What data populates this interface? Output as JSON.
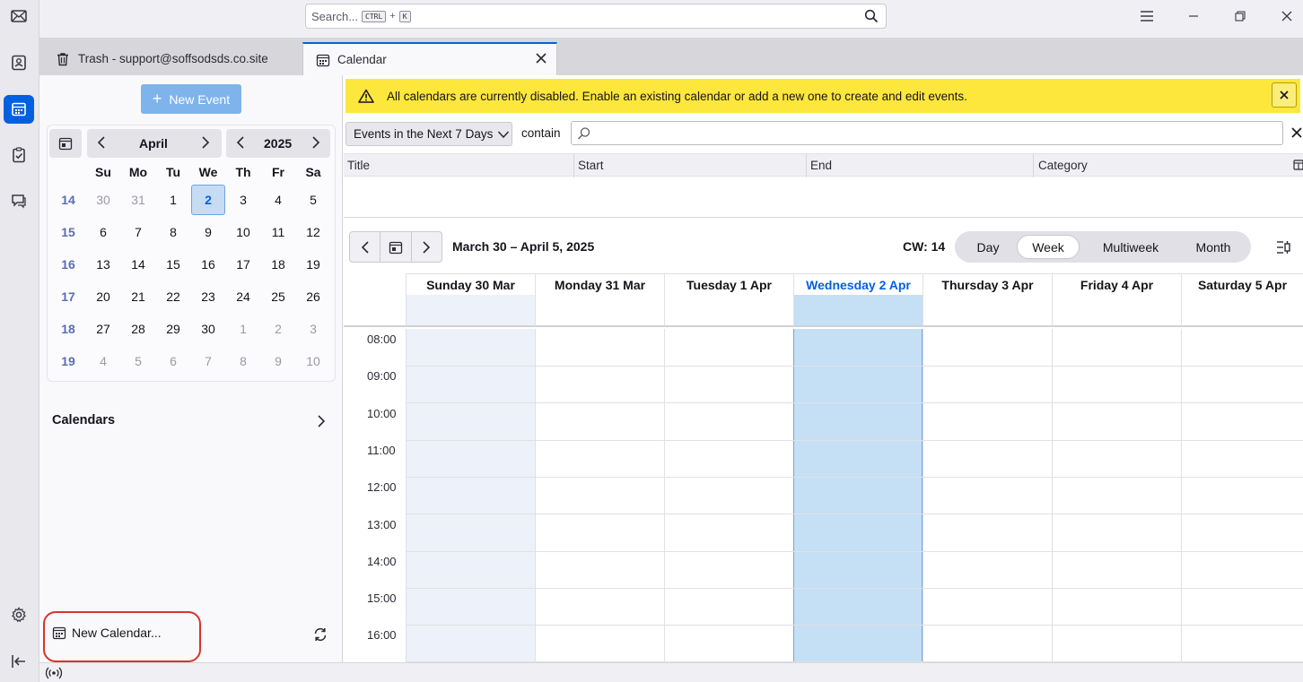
{
  "app": {
    "search_placeholder": "Search...",
    "search_key1": "CTRL",
    "search_plus": "+",
    "search_key2": "K"
  },
  "tabs": [
    {
      "label": "Trash - support@soffsodsds.co.site",
      "icon": "trash-icon"
    },
    {
      "label": "Calendar",
      "icon": "calendar-icon"
    }
  ],
  "left": {
    "new_event": "New Event",
    "minimonth": {
      "month": "April",
      "year": "2025",
      "day_headers": [
        "Su",
        "Mo",
        "Tu",
        "We",
        "Th",
        "Fr",
        "Sa"
      ],
      "weeks": [
        {
          "num": "14",
          "days": [
            "30",
            "31",
            "1",
            "2",
            "3",
            "4",
            "5"
          ]
        },
        {
          "num": "15",
          "days": [
            "6",
            "7",
            "8",
            "9",
            "10",
            "11",
            "12"
          ]
        },
        {
          "num": "16",
          "days": [
            "13",
            "14",
            "15",
            "16",
            "17",
            "18",
            "19"
          ]
        },
        {
          "num": "17",
          "days": [
            "20",
            "21",
            "22",
            "23",
            "24",
            "25",
            "26"
          ]
        },
        {
          "num": "18",
          "days": [
            "27",
            "28",
            "29",
            "30",
            "1",
            "2",
            "3"
          ]
        },
        {
          "num": "19",
          "days": [
            "4",
            "5",
            "6",
            "7",
            "8",
            "9",
            "10"
          ]
        }
      ],
      "today": "2"
    },
    "calendars_header": "Calendars",
    "new_calendar": "New Calendar..."
  },
  "main": {
    "notification": "All calendars are currently disabled. Enable an existing calendar or add a new one to create and edit events.",
    "filter_select": "Events in the Next 7 Days",
    "filter_text": "contain",
    "columns": [
      "Title",
      "Start",
      "End",
      "Category"
    ],
    "range_label": "March 30 – April 5, 2025",
    "cw_label": "CW: 14",
    "views": [
      "Day",
      "Week",
      "Multiweek",
      "Month"
    ],
    "active_view": "Week",
    "days": [
      "Sunday 30 Mar",
      "Monday 31 Mar",
      "Tuesday 1 Apr",
      "Wednesday 2 Apr",
      "Thursday 3 Apr",
      "Friday 4 Apr",
      "Saturday 5 Apr"
    ],
    "hours": [
      "08:00",
      "09:00",
      "10:00",
      "11:00",
      "12:00",
      "13:00",
      "14:00",
      "15:00",
      "16:00"
    ]
  },
  "colors": {
    "accent": "#0061e0",
    "today_column": "#c5dff4",
    "weekend_column": "#edf1f9",
    "notification_bg": "#fde73c",
    "highlight_ring": "#d9332c"
  }
}
